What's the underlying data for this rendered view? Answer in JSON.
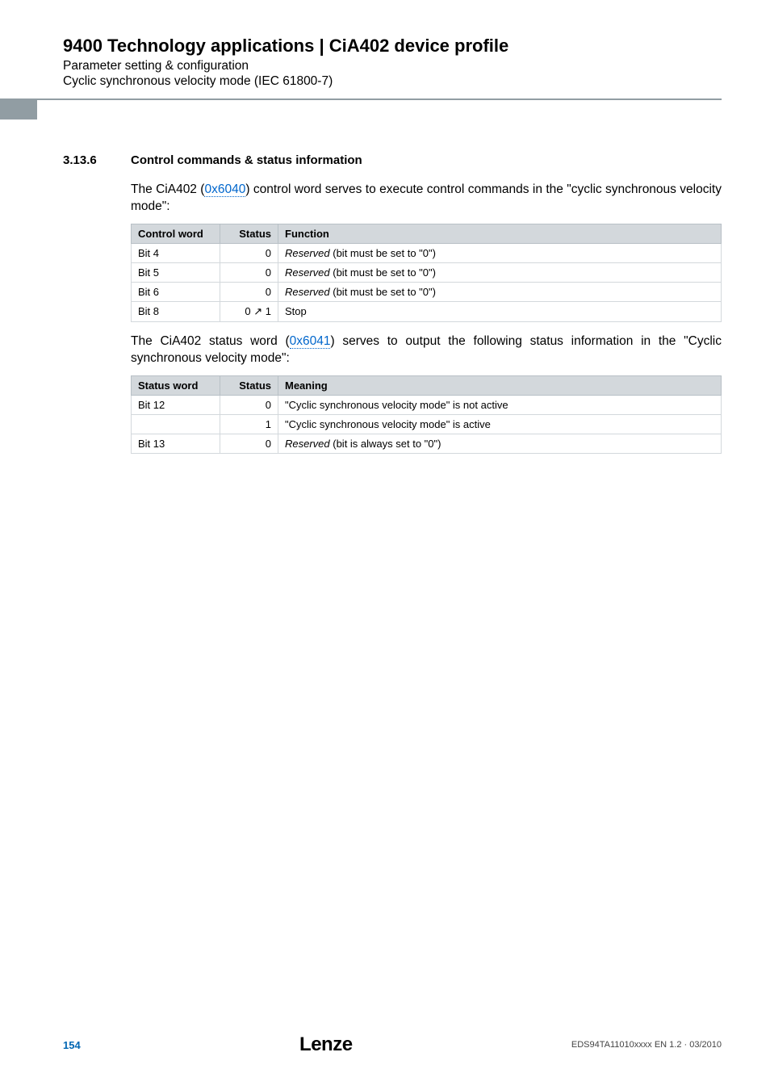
{
  "header": {
    "title": "9400 Technology applications | CiA402 device profile",
    "sub1": "Parameter setting & configuration",
    "sub2": "Cyclic synchronous velocity mode (IEC 61800-7)"
  },
  "section": {
    "num": "3.13.6",
    "title": "Control commands & status information"
  },
  "para1_a": "The CiA402 (",
  "para1_link": "0x6040",
  "para1_b": ") control word serves to execute control commands in the \"cyclic synchronous velocity mode\":",
  "ctrl_table": {
    "head": {
      "c1": "Control word",
      "c2": "Status",
      "c3": "Function"
    },
    "rows": [
      {
        "c1": "Bit 4",
        "c2": "0",
        "c3a": "Reserved",
        "c3b": " (bit must be set to \"0\")"
      },
      {
        "c1": "Bit 5",
        "c2": "0",
        "c3a": "Reserved",
        "c3b": " (bit must be set to \"0\")"
      },
      {
        "c1": "Bit 6",
        "c2": "0",
        "c3a": "Reserved",
        "c3b": " (bit must be set to \"0\")"
      },
      {
        "c1": "Bit 8",
        "c2": "0 ↗ 1",
        "c3a": "",
        "c3b": "Stop"
      }
    ]
  },
  "para2_a": "The CiA402 status word (",
  "para2_link": "0x6041",
  "para2_b": ") serves to output the following status information in the \"Cyclic synchronous velocity mode\":",
  "stat_table": {
    "head": {
      "c1": "Status word",
      "c2": "Status",
      "c3": "Meaning"
    },
    "rows": [
      {
        "c1": "Bit 12",
        "c2": "0",
        "c3a": "",
        "c3b": "\"Cyclic synchronous velocity mode\" is not active"
      },
      {
        "c1": "",
        "c2": "1",
        "c3a": "",
        "c3b": "\"Cyclic synchronous velocity mode\" is active"
      },
      {
        "c1": "Bit 13",
        "c2": "0",
        "c3a": "Reserved",
        "c3b": " (bit is always set to \"0\")"
      }
    ]
  },
  "footer": {
    "page": "154",
    "logo": "Lenze",
    "docid": "EDS94TA11010xxxx EN 1.2 · 03/2010"
  }
}
